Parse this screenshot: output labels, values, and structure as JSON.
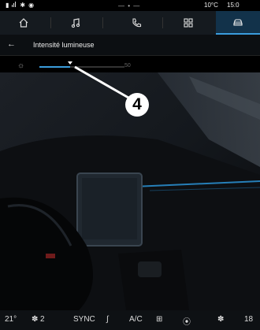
{
  "status": {
    "temperature": "10°C",
    "time": "15:0",
    "center_indicator": "— • —"
  },
  "header": {
    "title": "Intensité lumineuse"
  },
  "brightness": {
    "max_label": "50",
    "level_percent": 36
  },
  "callout": {
    "number": "4"
  },
  "bottom": {
    "temp_left": "21°",
    "fan_level": "2",
    "sync": "SYNC",
    "ac": "A/C",
    "temp_right": "18"
  },
  "icons": {
    "nav": [
      "home-icon",
      "music-icon",
      "phone-icon",
      "apps-icon",
      "car-icon"
    ],
    "accent_color": "#3a9cdc"
  }
}
